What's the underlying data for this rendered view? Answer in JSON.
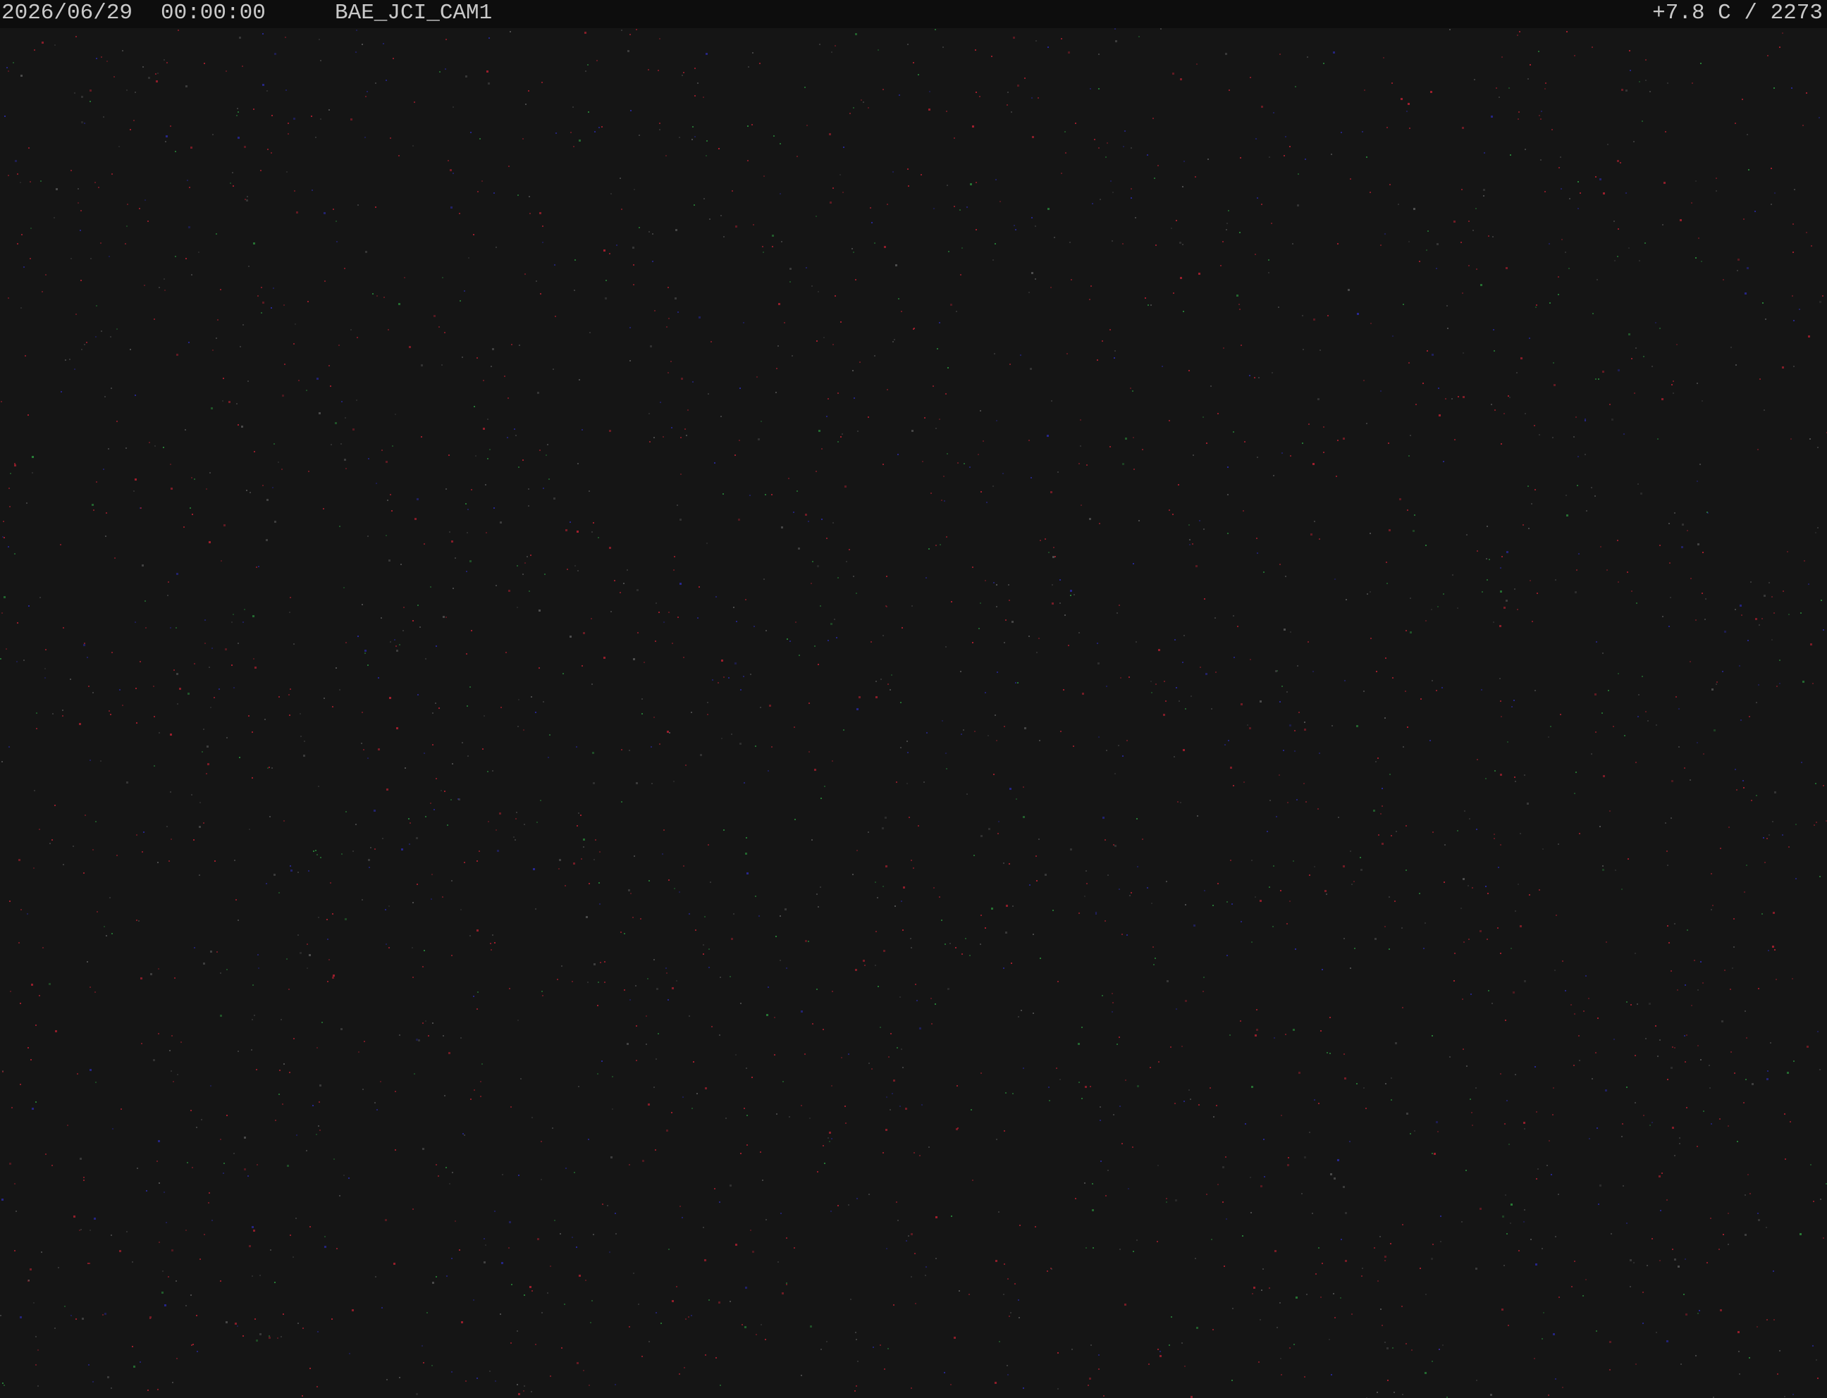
{
  "overlay": {
    "date": "2026/06/29",
    "time": "00:00:00",
    "camera_id": "BAE_JCI_CAM1",
    "status": "+7.8 C / 2273"
  },
  "colors": {
    "sky": "#151515",
    "overlay_bar": "#0d0d0d",
    "overlay_text": "#c9c9c9",
    "noise_red": "#b02030",
    "noise_blue": "#2a2aa0",
    "noise_green": "#2a8a3a"
  }
}
